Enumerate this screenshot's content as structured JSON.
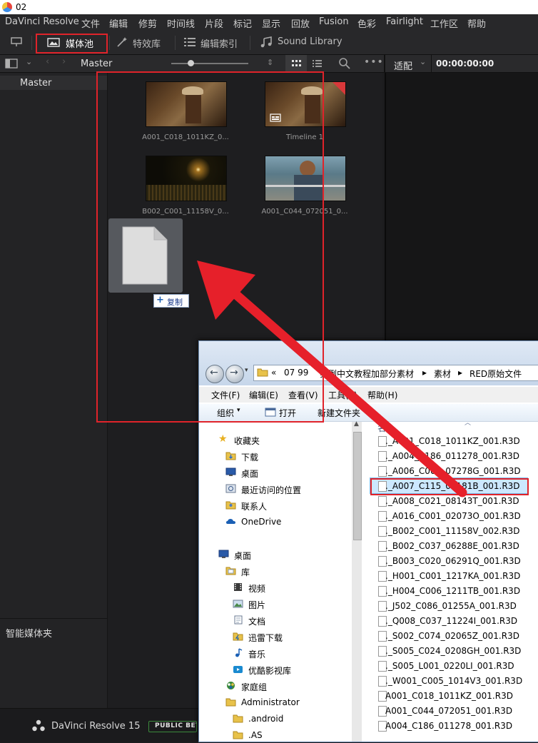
{
  "window": {
    "title": "02"
  },
  "menubar": [
    "DaVinci Resolve",
    "文件",
    "编辑",
    "修剪",
    "时间线",
    "片段",
    "标记",
    "显示",
    "回放",
    "Fusion",
    "色彩",
    "Fairlight",
    "工作区",
    "帮助"
  ],
  "toolbar": {
    "media_pool": "媒体池",
    "effects": "特效库",
    "edit_index": "编辑索引",
    "sound_library": "Sound Library"
  },
  "bar2": {
    "folder": "Master",
    "fit": "适配",
    "timecode": "00:00:00:00"
  },
  "sidebar": {
    "master": "Master",
    "smart_bins": "智能媒体夹"
  },
  "clips": [
    {
      "name": "A001_C018_1011KZ_0..."
    },
    {
      "name": "Timeline 1"
    },
    {
      "name": "B002_C001_11158V_0..."
    },
    {
      "name": "A001_C044_072051_0..."
    }
  ],
  "drag": {
    "copy_label": "复制"
  },
  "footer": {
    "app_name": "DaVinci Resolve 15",
    "badge": "PUBLIC BETA"
  },
  "explorer": {
    "breadcrumb": [
      "«",
      "07 99",
      "实例中文教程加部分素材",
      "素材",
      "RED原始文件"
    ],
    "menu": [
      "文件(F)",
      "编辑(E)",
      "查看(V)",
      "工具(T)",
      "帮助(H)"
    ],
    "commands": {
      "organize": "组织",
      "open": "打开",
      "new_folder": "新建文件夹"
    },
    "nav": [
      {
        "icon": "star-icon",
        "label": "收藏夹",
        "level": 0
      },
      {
        "icon": "download-folder-icon",
        "label": "下载",
        "level": 1
      },
      {
        "icon": "desktop-icon",
        "label": "桌面",
        "level": 1
      },
      {
        "icon": "recent-places-icon",
        "label": "最近访问的位置",
        "level": 1
      },
      {
        "icon": "contacts-folder-icon",
        "label": "联系人",
        "level": 1
      },
      {
        "icon": "onedrive-icon",
        "label": "OneDrive",
        "level": 1
      },
      {
        "icon": "desktop-icon",
        "label": "桌面",
        "level": 0
      },
      {
        "icon": "library-icon",
        "label": "库",
        "level": 1
      },
      {
        "icon": "video-icon",
        "label": "视频",
        "level": 2
      },
      {
        "icon": "pictures-icon",
        "label": "图片",
        "level": 2
      },
      {
        "icon": "documents-icon",
        "label": "文档",
        "level": 2
      },
      {
        "icon": "thunder-download-icon",
        "label": "迅雷下载",
        "level": 2
      },
      {
        "icon": "music-icon",
        "label": "音乐",
        "level": 2
      },
      {
        "icon": "youku-library-icon",
        "label": "优酷影视库",
        "level": 2
      },
      {
        "icon": "homegroup-icon",
        "label": "家庭组",
        "level": 1
      },
      {
        "icon": "user-folder-icon",
        "label": "Administrator",
        "level": 1
      },
      {
        "icon": "folder-icon",
        "label": ".android",
        "level": 2
      },
      {
        "icon": "folder-icon",
        "label": ".AS",
        "level": 2
      }
    ],
    "files_header": "名",
    "files": [
      "._A001_C018_1011KZ_001.R3D",
      "._A004_C186_011278_001.R3D",
      "._A006_C004_07278G_001.R3D",
      "._A007_C115_07181B_001.R3D",
      "._A008_C021_08143T_001.R3D",
      "._A016_C001_02073O_001.R3D",
      "._B002_C001_11158V_002.R3D",
      "._B002_C037_06288E_001.R3D",
      "._B003_C020_06291Q_001.R3D",
      "._H001_C001_1217KA_001.R3D",
      "._H004_C006_1211TB_001.R3D",
      "._J502_C086_01255A_001.R3D",
      "._Q008_C037_11224I_001.R3D",
      "._S002_C074_02065Z_001.R3D",
      "._S005_C024_0208GH_001.R3D",
      "._S005_L001_0220LI_001.R3D",
      "._W001_C005_1014V3_001.R3D",
      "A001_C018_1011KZ_001.R3D",
      "A001_C044_072051_001.R3D",
      "A004_C186_011278_001.R3D"
    ],
    "selected_file_index": 3
  },
  "colors": {
    "annotation_red": "#e0232a",
    "selection_blue": "#cce8ff"
  }
}
